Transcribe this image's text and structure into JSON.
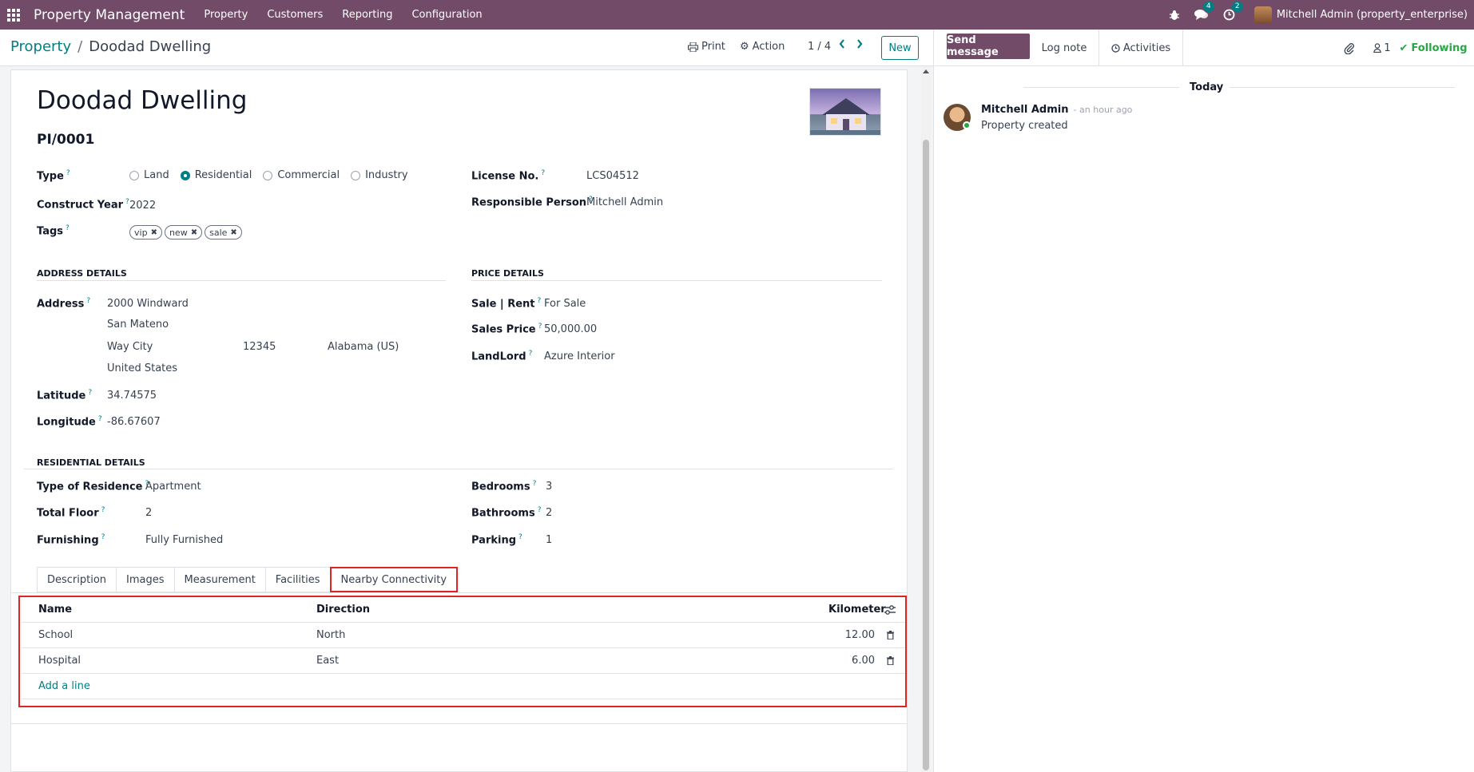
{
  "topbar": {
    "app_name": "Property Management",
    "menu": [
      "Property",
      "Customers",
      "Reporting",
      "Configuration"
    ],
    "messages_count": "4",
    "activities_count": "2",
    "user": "Mitchell Admin (property_enterprise)"
  },
  "control_panel": {
    "breadcrumb_parent": "Property",
    "breadcrumb_current": "Doodad Dwelling",
    "print_label": "Print",
    "action_label": "Action",
    "pager": "1 / 4",
    "new_label": "New"
  },
  "chatter_header": {
    "send_label": "Send message",
    "log_label": "Log note",
    "activities_label": "Activities",
    "followers_count": "1",
    "following_label": "Following"
  },
  "form": {
    "name": "Doodad Dwelling",
    "reference": "PI/0001",
    "type_label": "Type",
    "type_options": [
      "Land",
      "Residential",
      "Commercial",
      "Industry"
    ],
    "type_selected": "Residential",
    "construct_year_label": "Construct Year",
    "construct_year": "2022",
    "tags_label": "Tags",
    "tags": [
      "vip",
      "new",
      "sale"
    ],
    "license_label": "License No.",
    "license": "LCS04512",
    "responsible_label": "Responsible Person",
    "responsible": "Mitchell Admin",
    "address_section": "ADDRESS DETAILS",
    "address_label": "Address",
    "street": "2000 Windward",
    "street2": "San Mateno",
    "city": "Way City",
    "zip": "12345",
    "state": "Alabama (US)",
    "country": "United States",
    "latitude_label": "Latitude",
    "latitude": "34.74575",
    "longitude_label": "Longitude",
    "longitude": "-86.67607",
    "price_section": "PRICE DETAILS",
    "sale_rent_label": "Sale | Rent",
    "sale_rent": "For Sale",
    "sales_price_label": "Sales Price",
    "sales_price": "50,000.00",
    "landlord_label": "LandLord",
    "landlord": "Azure Interior",
    "residential_section": "RESIDENTIAL DETAILS",
    "residence_type_label": "Type of Residence",
    "residence_type": "Apartment",
    "total_floor_label": "Total Floor",
    "total_floor": "2",
    "furnishing_label": "Furnishing",
    "furnishing": "Fully Furnished",
    "bedrooms_label": "Bedrooms",
    "bedrooms": "3",
    "bathrooms_label": "Bathrooms",
    "bathrooms": "2",
    "parking_label": "Parking",
    "parking": "1"
  },
  "tabs": [
    "Description",
    "Images",
    "Measurement",
    "Facilities",
    "Nearby Connectivity"
  ],
  "active_tab": "Nearby Connectivity",
  "table": {
    "headers": [
      "Name",
      "Direction",
      "Kilometer"
    ],
    "rows": [
      {
        "name": "School",
        "direction": "North",
        "km": "12.00"
      },
      {
        "name": "Hospital",
        "direction": "East",
        "km": "6.00"
      }
    ],
    "add_line": "Add a line"
  },
  "chatter": {
    "date_label": "Today",
    "author": "Mitchell Admin",
    "time": "- an hour ago",
    "message": "Property created"
  },
  "colors": {
    "brand": "#714b67",
    "accent": "#017e84",
    "highlight": "#e02424",
    "success": "#28a745"
  }
}
